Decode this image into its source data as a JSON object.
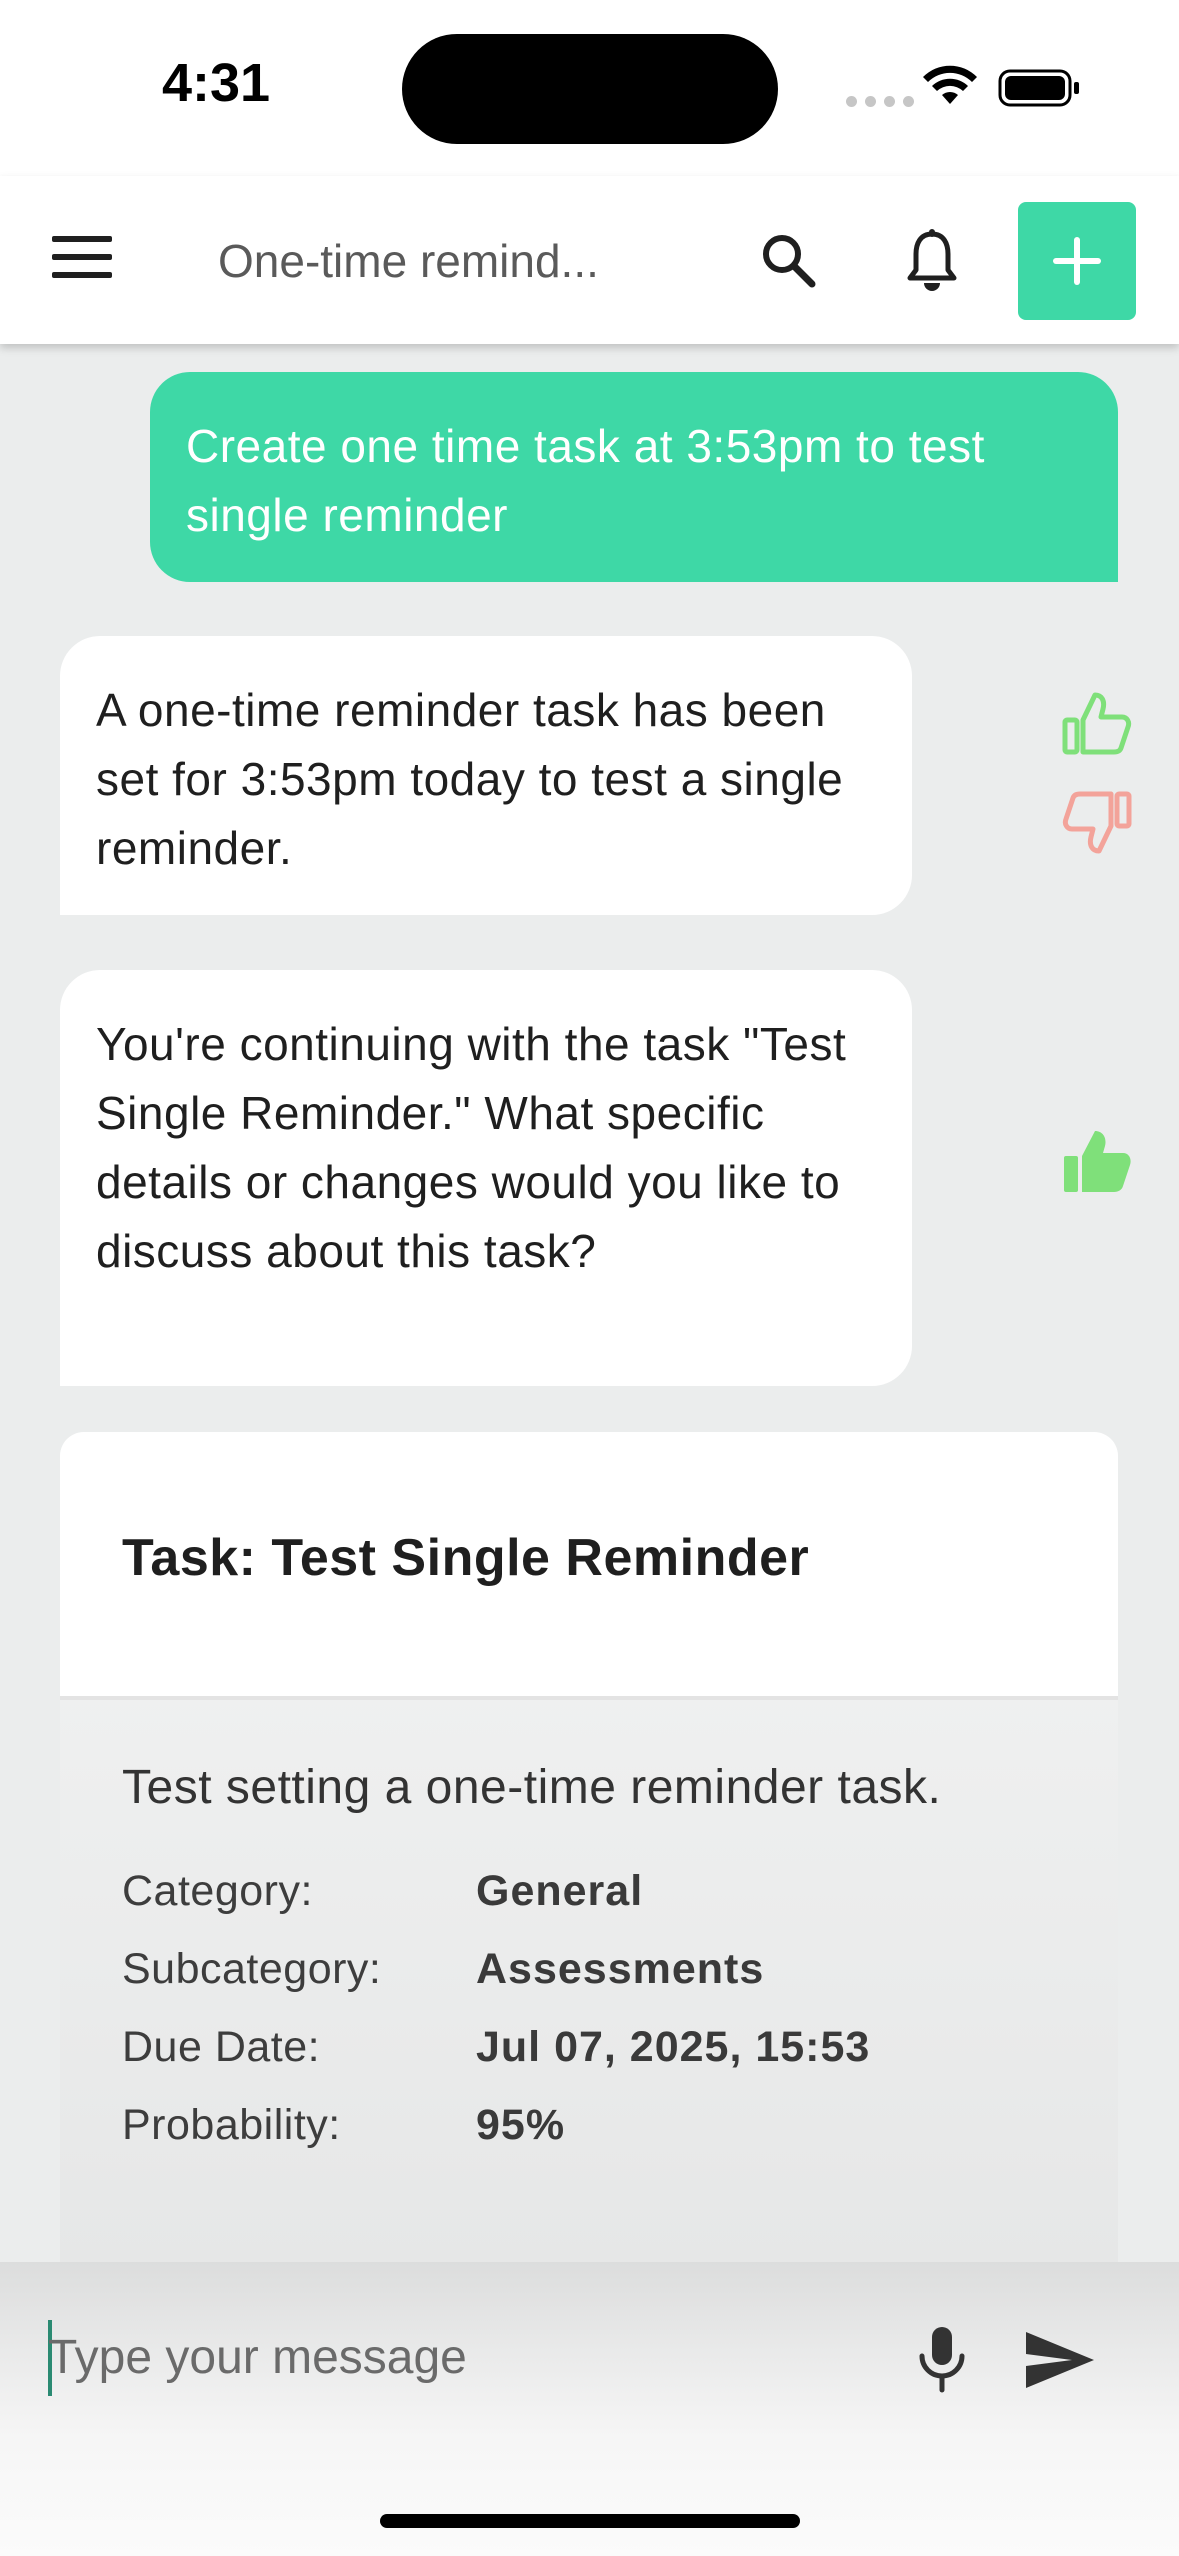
{
  "status_bar": {
    "time": "4:31"
  },
  "header": {
    "title": "One-time remind...",
    "icons": [
      "menu-icon",
      "search-icon",
      "bell-icon",
      "plus-icon"
    ]
  },
  "messages": [
    {
      "role": "user",
      "text": "Create one time task at 3:53pm to test single reminder"
    },
    {
      "role": "assistant",
      "text": "A one-time reminder task has been set for 3:53pm today to test a single reminder.",
      "feedback": [
        "thumbs-up-outline",
        "thumbs-down-outline"
      ]
    },
    {
      "role": "assistant",
      "text": "You're continuing with the task \"Test Single Reminder.\" What specific details or changes would you like to discuss about this task?",
      "feedback": [
        "thumbs-up-filled"
      ]
    }
  ],
  "task_card": {
    "title": "Task: Test Single Reminder",
    "description": "Test setting a one-time reminder task.",
    "fields": [
      {
        "label": "Category:",
        "value": "General"
      },
      {
        "label": "Subcategory:",
        "value": "Assessments"
      },
      {
        "label": "Due Date:",
        "value": "Jul 07, 2025, 15:53"
      },
      {
        "label": "Probability:",
        "value": "95%"
      }
    ]
  },
  "composer": {
    "placeholder": "Type your message"
  },
  "colors": {
    "accent": "#3ed8a6",
    "thumb_up": "#7fe07a",
    "thumb_down": "#f3a39a",
    "background": "#ebeded"
  }
}
